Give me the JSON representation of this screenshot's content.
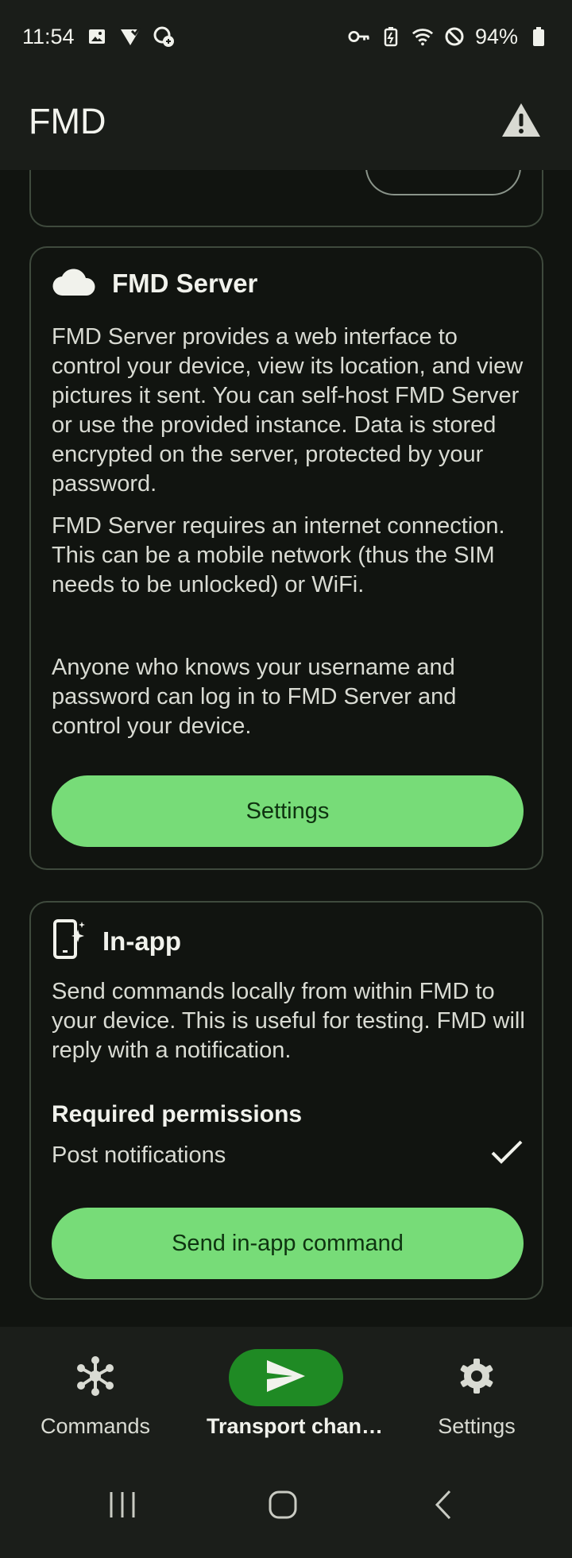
{
  "status_bar": {
    "time": "11:54",
    "battery": "94%",
    "left_icons": [
      "image-icon",
      "signal-check-icon",
      "sync-icon"
    ],
    "right_icons": [
      "vpn-key-icon",
      "battery-saver-icon",
      "wifi-icon",
      "do-not-disturb-icon",
      "battery-icon"
    ]
  },
  "app_bar": {
    "title": "FMD",
    "action_icon": "warning-icon"
  },
  "cards": {
    "fmd_server": {
      "icon": "cloud-icon",
      "title": "FMD Server",
      "paragraphs": [
        "FMD Server provides a web interface to control your device, view its location, and view pictures it sent. You can self-host FMD Server or use the provided instance. Data is stored encrypted on the server, protected by your password.",
        "FMD Server requires an internet connection. This can be a mobile network (thus the SIM needs to be unlocked) or WiFi.",
        "Anyone who knows your username and password can log in to FMD Server and control your device."
      ],
      "button_label": "Settings"
    },
    "in_app": {
      "icon": "phone-sparkle-icon",
      "title": "In-app",
      "description": "Send commands locally from within FMD to your device. This is useful for testing. FMD will reply with a notification.",
      "permissions_title": "Required permissions",
      "permissions": [
        {
          "label": "Post notifications",
          "granted": true
        }
      ],
      "button_label": "Send in-app command"
    }
  },
  "bottom_nav": {
    "items": [
      {
        "label": "Commands",
        "icon": "hub-icon",
        "active": false
      },
      {
        "label": "Transport chan…",
        "icon": "send-icon",
        "active": true
      },
      {
        "label": "Settings",
        "icon": "gear-icon",
        "active": false
      }
    ]
  },
  "colors": {
    "accent_button": "#77dc78",
    "active_nav": "#1f8a24",
    "background": "#111410",
    "card_border": "#3f4a3d"
  }
}
